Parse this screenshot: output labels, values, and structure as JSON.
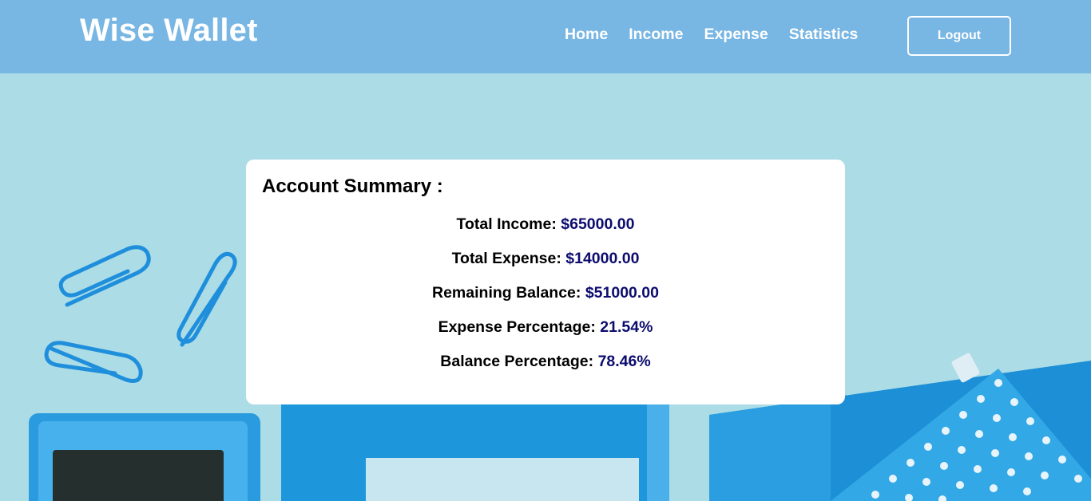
{
  "header": {
    "brand": "Wise Wallet",
    "nav": [
      {
        "label": "Home"
      },
      {
        "label": "Income"
      },
      {
        "label": "Expense"
      },
      {
        "label": "Statistics"
      }
    ],
    "logout_label": "Logout"
  },
  "summary": {
    "title": "Account Summary :",
    "rows": [
      {
        "label": "Total Income:",
        "value": "$65000.00"
      },
      {
        "label": "Total Expense:",
        "value": "$14000.00"
      },
      {
        "label": "Remaining Balance:",
        "value": "$51000.00"
      },
      {
        "label": "Expense Percentage:",
        "value": "21.54%"
      },
      {
        "label": "Balance Percentage:",
        "value": "78.46%"
      }
    ]
  },
  "colors": {
    "header_bg": "#78b6e4",
    "page_bg": "#acdce6",
    "value_text": "#0c0c6e"
  }
}
